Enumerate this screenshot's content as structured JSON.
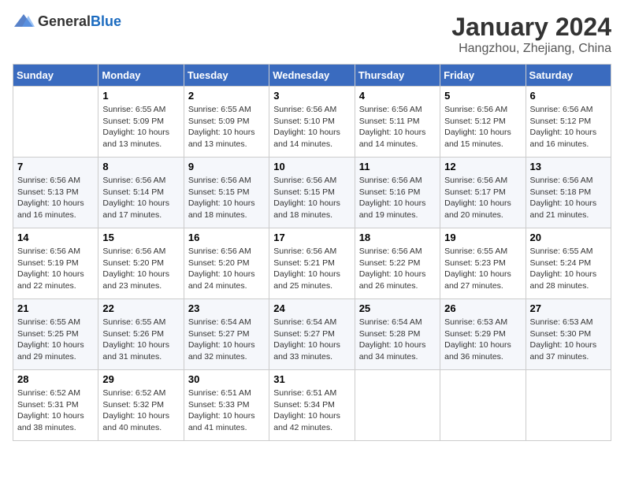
{
  "header": {
    "logo_general": "General",
    "logo_blue": "Blue",
    "month_title": "January 2024",
    "location": "Hangzhou, Zhejiang, China"
  },
  "days_of_week": [
    "Sunday",
    "Monday",
    "Tuesday",
    "Wednesday",
    "Thursday",
    "Friday",
    "Saturday"
  ],
  "weeks": [
    [
      {
        "day": "",
        "details": ""
      },
      {
        "day": "1",
        "details": "Sunrise: 6:55 AM\nSunset: 5:09 PM\nDaylight: 10 hours\nand 13 minutes."
      },
      {
        "day": "2",
        "details": "Sunrise: 6:55 AM\nSunset: 5:09 PM\nDaylight: 10 hours\nand 13 minutes."
      },
      {
        "day": "3",
        "details": "Sunrise: 6:56 AM\nSunset: 5:10 PM\nDaylight: 10 hours\nand 14 minutes."
      },
      {
        "day": "4",
        "details": "Sunrise: 6:56 AM\nSunset: 5:11 PM\nDaylight: 10 hours\nand 14 minutes."
      },
      {
        "day": "5",
        "details": "Sunrise: 6:56 AM\nSunset: 5:12 PM\nDaylight: 10 hours\nand 15 minutes."
      },
      {
        "day": "6",
        "details": "Sunrise: 6:56 AM\nSunset: 5:12 PM\nDaylight: 10 hours\nand 16 minutes."
      }
    ],
    [
      {
        "day": "7",
        "details": "Sunrise: 6:56 AM\nSunset: 5:13 PM\nDaylight: 10 hours\nand 16 minutes."
      },
      {
        "day": "8",
        "details": "Sunrise: 6:56 AM\nSunset: 5:14 PM\nDaylight: 10 hours\nand 17 minutes."
      },
      {
        "day": "9",
        "details": "Sunrise: 6:56 AM\nSunset: 5:15 PM\nDaylight: 10 hours\nand 18 minutes."
      },
      {
        "day": "10",
        "details": "Sunrise: 6:56 AM\nSunset: 5:15 PM\nDaylight: 10 hours\nand 18 minutes."
      },
      {
        "day": "11",
        "details": "Sunrise: 6:56 AM\nSunset: 5:16 PM\nDaylight: 10 hours\nand 19 minutes."
      },
      {
        "day": "12",
        "details": "Sunrise: 6:56 AM\nSunset: 5:17 PM\nDaylight: 10 hours\nand 20 minutes."
      },
      {
        "day": "13",
        "details": "Sunrise: 6:56 AM\nSunset: 5:18 PM\nDaylight: 10 hours\nand 21 minutes."
      }
    ],
    [
      {
        "day": "14",
        "details": "Sunrise: 6:56 AM\nSunset: 5:19 PM\nDaylight: 10 hours\nand 22 minutes."
      },
      {
        "day": "15",
        "details": "Sunrise: 6:56 AM\nSunset: 5:20 PM\nDaylight: 10 hours\nand 23 minutes."
      },
      {
        "day": "16",
        "details": "Sunrise: 6:56 AM\nSunset: 5:20 PM\nDaylight: 10 hours\nand 24 minutes."
      },
      {
        "day": "17",
        "details": "Sunrise: 6:56 AM\nSunset: 5:21 PM\nDaylight: 10 hours\nand 25 minutes."
      },
      {
        "day": "18",
        "details": "Sunrise: 6:56 AM\nSunset: 5:22 PM\nDaylight: 10 hours\nand 26 minutes."
      },
      {
        "day": "19",
        "details": "Sunrise: 6:55 AM\nSunset: 5:23 PM\nDaylight: 10 hours\nand 27 minutes."
      },
      {
        "day": "20",
        "details": "Sunrise: 6:55 AM\nSunset: 5:24 PM\nDaylight: 10 hours\nand 28 minutes."
      }
    ],
    [
      {
        "day": "21",
        "details": "Sunrise: 6:55 AM\nSunset: 5:25 PM\nDaylight: 10 hours\nand 29 minutes."
      },
      {
        "day": "22",
        "details": "Sunrise: 6:55 AM\nSunset: 5:26 PM\nDaylight: 10 hours\nand 31 minutes."
      },
      {
        "day": "23",
        "details": "Sunrise: 6:54 AM\nSunset: 5:27 PM\nDaylight: 10 hours\nand 32 minutes."
      },
      {
        "day": "24",
        "details": "Sunrise: 6:54 AM\nSunset: 5:27 PM\nDaylight: 10 hours\nand 33 minutes."
      },
      {
        "day": "25",
        "details": "Sunrise: 6:54 AM\nSunset: 5:28 PM\nDaylight: 10 hours\nand 34 minutes."
      },
      {
        "day": "26",
        "details": "Sunrise: 6:53 AM\nSunset: 5:29 PM\nDaylight: 10 hours\nand 36 minutes."
      },
      {
        "day": "27",
        "details": "Sunrise: 6:53 AM\nSunset: 5:30 PM\nDaylight: 10 hours\nand 37 minutes."
      }
    ],
    [
      {
        "day": "28",
        "details": "Sunrise: 6:52 AM\nSunset: 5:31 PM\nDaylight: 10 hours\nand 38 minutes."
      },
      {
        "day": "29",
        "details": "Sunrise: 6:52 AM\nSunset: 5:32 PM\nDaylight: 10 hours\nand 40 minutes."
      },
      {
        "day": "30",
        "details": "Sunrise: 6:51 AM\nSunset: 5:33 PM\nDaylight: 10 hours\nand 41 minutes."
      },
      {
        "day": "31",
        "details": "Sunrise: 6:51 AM\nSunset: 5:34 PM\nDaylight: 10 hours\nand 42 minutes."
      },
      {
        "day": "",
        "details": ""
      },
      {
        "day": "",
        "details": ""
      },
      {
        "day": "",
        "details": ""
      }
    ]
  ]
}
